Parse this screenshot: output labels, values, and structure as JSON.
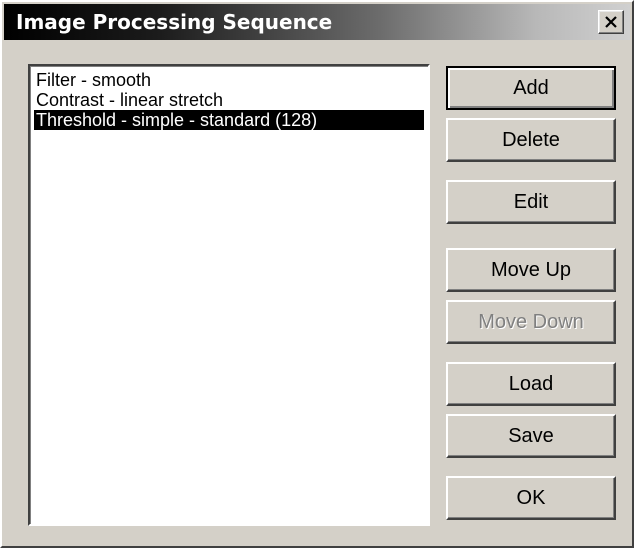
{
  "dialog": {
    "title": "Image Processing Sequence",
    "close_label": "close"
  },
  "sequence": {
    "items": [
      {
        "label": "Filter - smooth",
        "selected": false
      },
      {
        "label": "Contrast - linear stretch",
        "selected": false
      },
      {
        "label": "Threshold - simple - standard (128)",
        "selected": true
      }
    ]
  },
  "buttons": {
    "add": "Add",
    "delete": "Delete",
    "edit": "Edit",
    "move_up": "Move Up",
    "move_down": "Move Down",
    "load": "Load",
    "save": "Save",
    "ok": "OK"
  },
  "colors": {
    "face": "#d4d0c8",
    "selection_bg": "#000000",
    "selection_fg": "#ffffff",
    "disabled_text": "#808080"
  }
}
